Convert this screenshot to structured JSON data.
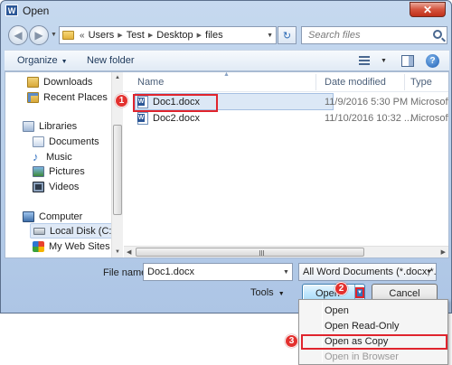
{
  "window": {
    "title": "Open",
    "app_icon_letter": "W",
    "close_glyph": "✕"
  },
  "address": {
    "chevrons": "«",
    "crumbs": [
      "Users",
      "Test",
      "Desktop",
      "files"
    ],
    "refresh_glyph": "↻",
    "search_placeholder": "Search files"
  },
  "toolbar": {
    "organize_label": "Organize",
    "new_folder_label": "New folder",
    "help_glyph": "?"
  },
  "navpane": {
    "items": [
      {
        "label": "Downloads",
        "icon": "downloads-icon"
      },
      {
        "label": "Recent Places",
        "icon": "recent-places-icon"
      },
      {
        "label": "Libraries",
        "icon": "libraries-icon"
      },
      {
        "label": "Documents",
        "icon": "documents-icon"
      },
      {
        "label": "Music",
        "icon": "music-icon"
      },
      {
        "label": "Pictures",
        "icon": "pictures-icon"
      },
      {
        "label": "Videos",
        "icon": "videos-icon"
      },
      {
        "label": "Computer",
        "icon": "computer-icon"
      },
      {
        "label": "Local Disk (C:)",
        "icon": "disk-icon"
      },
      {
        "label": "My Web Sites on",
        "icon": "web-sites-icon"
      }
    ]
  },
  "filelist": {
    "columns": {
      "name": "Name",
      "date": "Date modified",
      "type": "Type"
    },
    "rows": [
      {
        "name": "Doc1.docx",
        "date": "11/9/2016 5:30 PM",
        "type": "Microsoft"
      },
      {
        "name": "Doc2.docx",
        "date": "11/10/2016 10:32 ...",
        "type": "Microsoft"
      }
    ]
  },
  "footer": {
    "filename_label": "File name:",
    "filename_value": "Doc1.docx",
    "filetype_value": "All Word Documents (*.docx;*.d",
    "tools_label": "Tools",
    "open_label": "Open",
    "cancel_label": "Cancel"
  },
  "open_menu": {
    "items": [
      "Open",
      "Open Read-Only",
      "Open as Copy",
      "Open in Browser"
    ]
  },
  "callouts": {
    "one": "1",
    "two": "2",
    "three": "3"
  },
  "colors": {
    "highlight_border": "#e0242d",
    "callout_fill": "#e3312f",
    "selection_fill": "#dce8f6"
  }
}
